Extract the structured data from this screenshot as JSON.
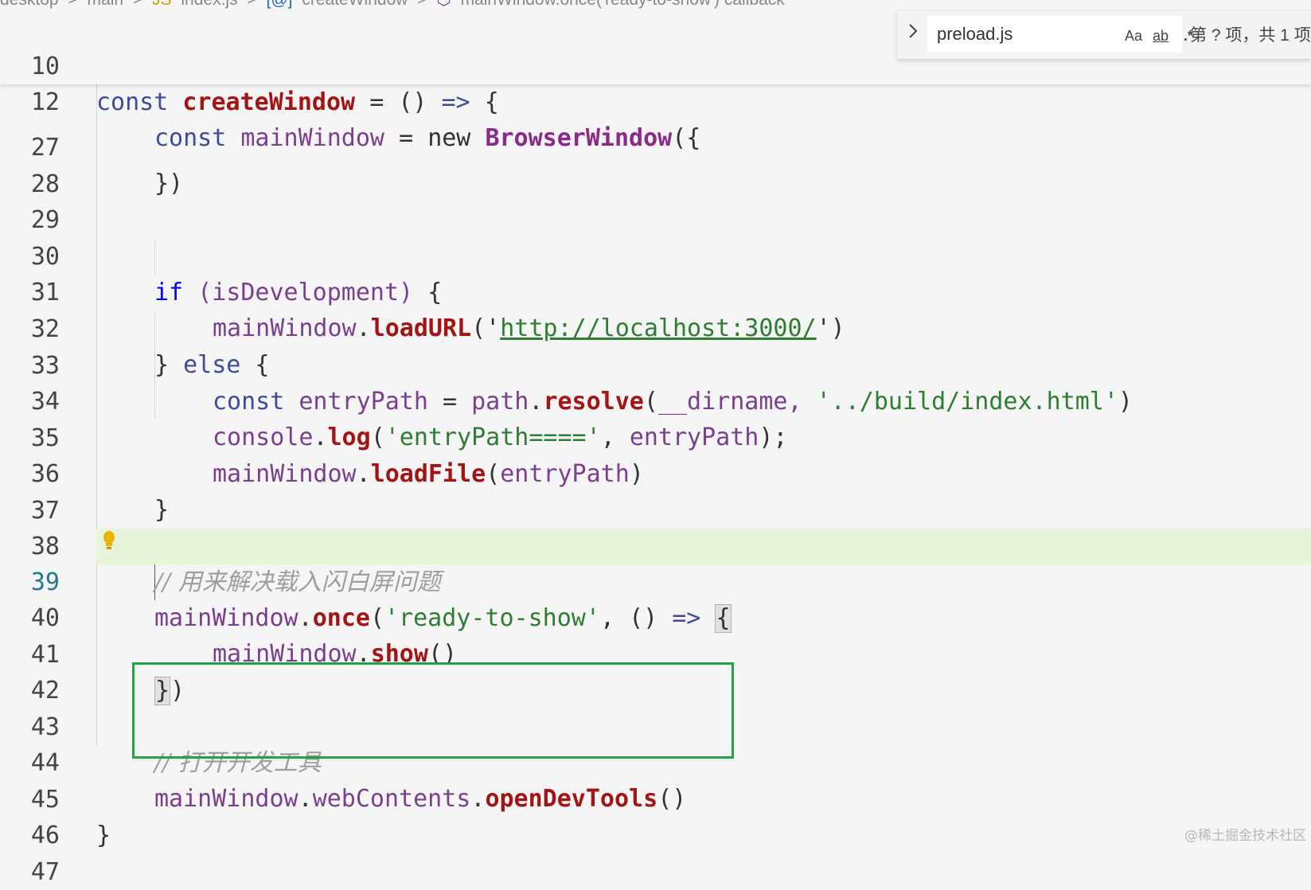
{
  "breadcrumb": {
    "items": [
      "desktop",
      ">",
      "main",
      ">",
      "JS",
      "index.js",
      ">",
      "[@]",
      "createWindow",
      ">",
      "⬡",
      "mainWindow.once('ready-to-show') callback"
    ]
  },
  "sticky_lines": [
    {
      "number": "10"
    },
    {
      "number": "12"
    }
  ],
  "code_lines": [
    {
      "number": "27",
      "active": false
    },
    {
      "number": "28",
      "active": false
    },
    {
      "number": "29",
      "active": false
    },
    {
      "number": "30",
      "active": false
    },
    {
      "number": "31",
      "active": false
    },
    {
      "number": "32",
      "active": false
    },
    {
      "number": "33",
      "active": false
    },
    {
      "number": "34",
      "active": false
    },
    {
      "number": "35",
      "active": false
    },
    {
      "number": "36",
      "active": false
    },
    {
      "number": "37",
      "active": false
    },
    {
      "number": "38",
      "active": false
    },
    {
      "number": "39",
      "active": true
    },
    {
      "number": "40",
      "active": false
    },
    {
      "number": "41",
      "active": false
    },
    {
      "number": "42",
      "active": false
    },
    {
      "number": "43",
      "active": false
    },
    {
      "number": "44",
      "active": false
    },
    {
      "number": "45",
      "active": false
    },
    {
      "number": "46",
      "active": false
    },
    {
      "number": "47",
      "active": false
    }
  ],
  "tokens": {
    "const": "const",
    "createWindow": "createWindow",
    "eq": "=",
    "parens": "()",
    "arrow": "=>",
    "open_brace": "{",
    "mainWindow": "mainWindow",
    "new": "new",
    "BrowserWindow": "BrowserWindow",
    "paren_brace": "({",
    "close_obj": "})",
    "if": "if",
    "isDevelopment": "(isDevelopment)",
    "loadURL": "loadURL",
    "url": "http://localhost:3000/",
    "else": "else",
    "entryPath": "entryPath",
    "path": "path",
    "resolve": "resolve",
    "dirname": "__dirname,",
    "build_str": "'../build/index.html'",
    "console": "console",
    "log": "log",
    "log_str": "'entryPath===='",
    "loadFile": "loadFile",
    "comment1": "// 用来解决载入闪白屏问题",
    "once": "once",
    "ready_str": "'ready-to-show'",
    "show": "show",
    "comment2": "// 打开开发工具",
    "webContents": "webContents",
    "openDevTools": "openDevTools"
  },
  "find_widget": {
    "toggle_icon": "chevron-right-icon",
    "query": "preload.js",
    "match_case_label": "Aa",
    "whole_word_label": "ab",
    "regex_label": ".*",
    "result_count": "第 ? 项，共 1 项"
  },
  "watermark": "@稀土掘金技术社区",
  "colors": {
    "keyword": "#0000ff",
    "function": "#a31515",
    "string": "#2e7d32",
    "variable": "#7a3f8f",
    "highlight_line": "#e6f4d9",
    "box": "#22a24a"
  }
}
